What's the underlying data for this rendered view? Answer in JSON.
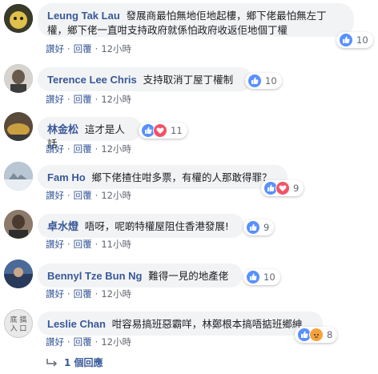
{
  "actions": {
    "like": "讚好",
    "reply": "回覆",
    "separator": "·"
  },
  "comments": [
    {
      "name": "Leung Tak Lau",
      "line1": "發展商最怕無地佢地起樓，鄉下佬最怕無左丁",
      "line2": "權，鄉下佬一直咁支持政府就係怕政府收返佢地個丁權",
      "time": "12小時",
      "reactions": "10",
      "react_types": [
        "like"
      ]
    },
    {
      "name": "Terence Lee Chris",
      "line1": "支持取消丁屋丁權制",
      "time": "12小時",
      "reactions": "10",
      "react_types": [
        "like"
      ]
    },
    {
      "name": "林金松",
      "line1": "這才是人話",
      "time": "12小時",
      "reactions": "11",
      "react_types": [
        "like",
        "love"
      ]
    },
    {
      "name": "Fam Ho",
      "line1": "鄉下佬揸住咁多票，有權的人那敢得罪？",
      "time": "12小時",
      "reactions": "9",
      "react_types": [
        "like",
        "love"
      ]
    },
    {
      "name": "卓水燈",
      "line1": "唔呀，呢啲特權屋阻住香港發展!",
      "time": "11小時",
      "reactions": "9",
      "react_types": [
        "like"
      ]
    },
    {
      "name": "Bennyl Tze Bun Ng",
      "line1": "難得一見的地產佬",
      "time": "12小時",
      "reactions": "10",
      "react_types": [
        "like"
      ]
    },
    {
      "name": "Leslie Chan",
      "line1": "咁容易搞班惡霸咩，林鄭根本搞唔掂班鄉紳",
      "time": "12小時",
      "reactions": "8",
      "react_types": [
        "like",
        "angry"
      ],
      "avatar_text": "底 搞 入 口"
    }
  ],
  "replies_label": "1 個回應",
  "colors": {
    "link": "#385898",
    "like": "#5890ff",
    "love": "#f25268",
    "angry": "#f6a23b",
    "bubble": "#f2f3f5"
  }
}
